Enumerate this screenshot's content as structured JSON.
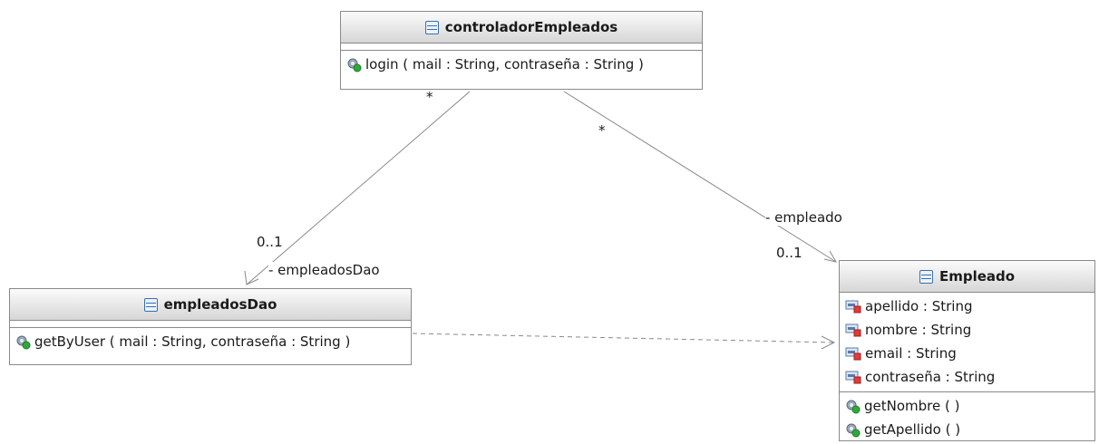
{
  "diagram": {
    "classes": {
      "controlador": {
        "name": "controladorEmpleados",
        "operations": [
          "login ( mail : String, contraseña : String )"
        ]
      },
      "dao": {
        "name": "empleadosDao",
        "operations": [
          "getByUser ( mail : String, contraseña : String )"
        ]
      },
      "empleado": {
        "name": "Empleado",
        "attributes": [
          "apellido : String",
          "nombre : String",
          "email : String",
          "contraseña : String"
        ],
        "operations": [
          "getNombre ( )",
          "getApellido ( )"
        ]
      }
    },
    "associations": {
      "to_dao": {
        "source_multiplicity": "*",
        "target_multiplicity": "0..1",
        "role": "- empleadosDao"
      },
      "to_empleado": {
        "source_multiplicity": "*",
        "target_multiplicity": "0..1",
        "role": "- empleado"
      }
    },
    "icons": {
      "class": "class-icon",
      "operation": "public-operation-icon",
      "attribute": "private-attribute-icon"
    },
    "colors": {
      "header_top": "#fbfbfb",
      "header_bottom": "#d6d6d6",
      "border": "#8a8a8a",
      "edge": "#8a8a8a"
    }
  }
}
